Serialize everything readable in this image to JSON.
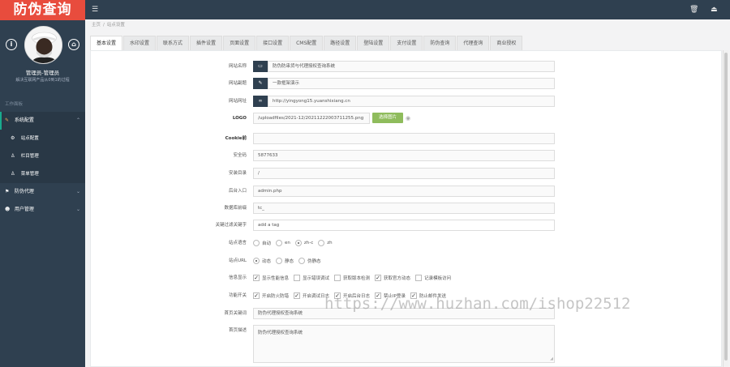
{
  "sidebar": {
    "logo": "防伪查询",
    "user_name": "管理员-管理员",
    "user_motto": "解决互联网产品从0到1的过程",
    "info_icon": "i",
    "home_icon": "⌂",
    "nav_header": "工作面板",
    "items": [
      {
        "label": "系统配置",
        "icon": "wrench-icon",
        "glyph": "✎",
        "chevron": "⌃"
      },
      {
        "label": "防伪代理",
        "icon": "bookmark-icon",
        "glyph": "⚑",
        "chevron": "⌄"
      },
      {
        "label": "用户管理",
        "icon": "users-icon",
        "glyph": "☻",
        "chevron": "⌄"
      }
    ],
    "sub_items": [
      {
        "label": "站点配置",
        "glyph": "⚙"
      },
      {
        "label": "栏目管理",
        "glyph": "♙"
      },
      {
        "label": "菜单管理",
        "glyph": "♙"
      }
    ]
  },
  "topbar": {
    "menu_glyph": "☰",
    "trash_glyph": "🗑",
    "exit_glyph": "⏏"
  },
  "breadcrumb": {
    "home": "主页",
    "sep": "/",
    "current": "站点设置"
  },
  "tabs": [
    "基本设置",
    "水印设置",
    "联系方式",
    "插件设置",
    "页面设置",
    "接口设置",
    "CMS配置",
    "路径设置",
    "登陆设置",
    "支付设置",
    "防伪查询",
    "代理查询",
    "商业授权"
  ],
  "form": {
    "site_name_label": "网站名称",
    "site_name_value": "防伪防串货与代理授权查询系统",
    "site_title_label": "网站副题",
    "site_title_value": "一款框架演示",
    "site_url_label": "网站网址",
    "site_url_value": "http://yingyong15.yuanshixiang.cn",
    "logo_label": "LOGO",
    "logo_value": "/uploadfiles/2021-12/20211222003711255.png",
    "upload_button": "选择图片",
    "preview_glyph": "◉",
    "cookie_label": "Cookie前",
    "cookie_value": "",
    "security_code_label": "安全码",
    "security_code_value": "5877633",
    "install_dir_label": "安装目录",
    "install_dir_value": "/",
    "admin_entry_label": "后台入口",
    "admin_entry_value": "admin.php",
    "db_prefix_label": "数据库前缀",
    "db_prefix_value": "tc_",
    "filter_keywords_label": "关键过滤关键字",
    "filter_keywords_value": "add a tag",
    "language_label": "站点语言",
    "language_options": [
      {
        "label": "自动",
        "checked": false
      },
      {
        "label": "en",
        "checked": false
      },
      {
        "label": "zh-c",
        "checked": true
      },
      {
        "label": "zh",
        "checked": false
      }
    ],
    "url_mode_label": "站点URL",
    "url_mode_options": [
      {
        "label": "动态",
        "checked": true
      },
      {
        "label": "静态",
        "checked": false
      },
      {
        "label": "伪静态",
        "checked": false
      }
    ],
    "info_display_label": "信息显示",
    "info_display_options": [
      {
        "label": "显示性能信息",
        "checked": true
      },
      {
        "label": "显示错误调试",
        "checked": false
      },
      {
        "label": "获取版本检测",
        "checked": false
      },
      {
        "label": "获取官方动态",
        "checked": true
      },
      {
        "label": "记录模板访问",
        "checked": false
      }
    ],
    "features_label": "功能开关",
    "features_options": [
      {
        "label": "开启防火防错",
        "checked": true
      },
      {
        "label": "开启调试日志",
        "checked": true
      },
      {
        "label": "开启后台日志",
        "checked": true
      },
      {
        "label": "禁止IP登录",
        "checked": true
      },
      {
        "label": "防止邮件发送",
        "checked": true
      }
    ],
    "home_keywords_label": "首页关键词",
    "home_keywords_value": "防伪代理授权查询系统",
    "home_desc_label": "首页描述",
    "home_desc_value": "防伪代理授权查询系统"
  },
  "watermark": "https://www.huzhan.com/ishop22512",
  "colors": {
    "sidebar_bg": "#2f4050",
    "logo_bg": "#e84c3d",
    "upload_btn": "#8fbc5c",
    "accent": "#19aa8d"
  }
}
